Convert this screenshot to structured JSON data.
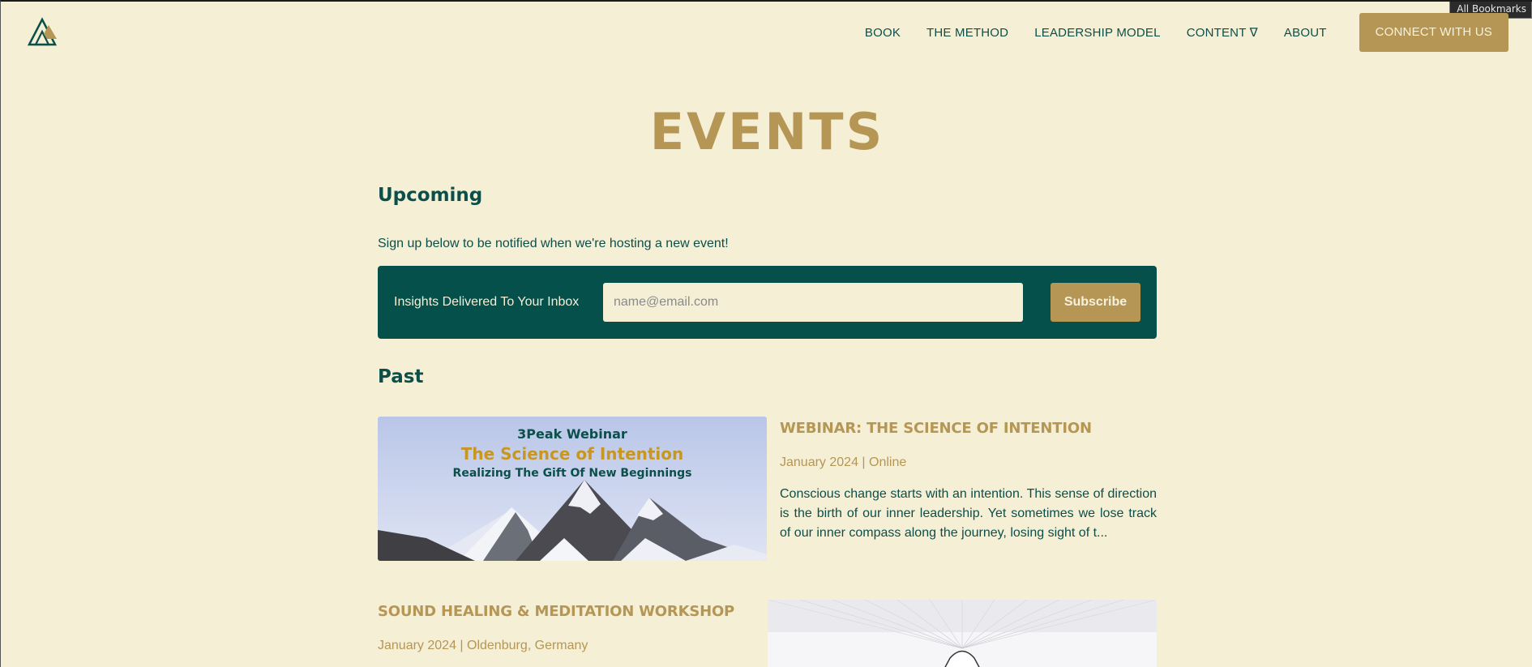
{
  "browser": {
    "bookmarks_label": "All Bookmarks"
  },
  "header": {
    "nav": [
      {
        "label": "BOOK"
      },
      {
        "label": "THE METHOD"
      },
      {
        "label": "LEADERSHIP MODEL"
      },
      {
        "label": "CONTENT ∇"
      },
      {
        "label": "ABOUT"
      }
    ],
    "cta_label": "CONNECT WITH US"
  },
  "page": {
    "title": "EVENTS"
  },
  "upcoming": {
    "heading": "Upcoming",
    "signup_text": "Sign up below to be notified when we're hosting a new event!",
    "newsletter": {
      "label": "Insights Delivered To Your Inbox",
      "placeholder": "name@email.com",
      "button_label": "Subscribe"
    }
  },
  "past": {
    "heading": "Past",
    "events": [
      {
        "title": "WEBINAR: THE SCIENCE OF INTENTION",
        "meta": "January 2024 | Online",
        "description": "Conscious change starts with an intention. This sense of direction is the birth of our inner leadership. Yet sometimes we lose track of our inner compass along the journey, losing sight of t...",
        "image_text": {
          "line1": "3Peak Webinar",
          "line2": "The Science of Intention",
          "line3": "Realizing The Gift Of New Beginnings"
        }
      },
      {
        "title": "SOUND HEALING & MEDITATION WORKSHOP",
        "meta": "January 2024 | Oldenburg, Germany"
      }
    ]
  },
  "colors": {
    "background": "#f5efd6",
    "primary_green": "#05504a",
    "gold": "#b59654"
  }
}
